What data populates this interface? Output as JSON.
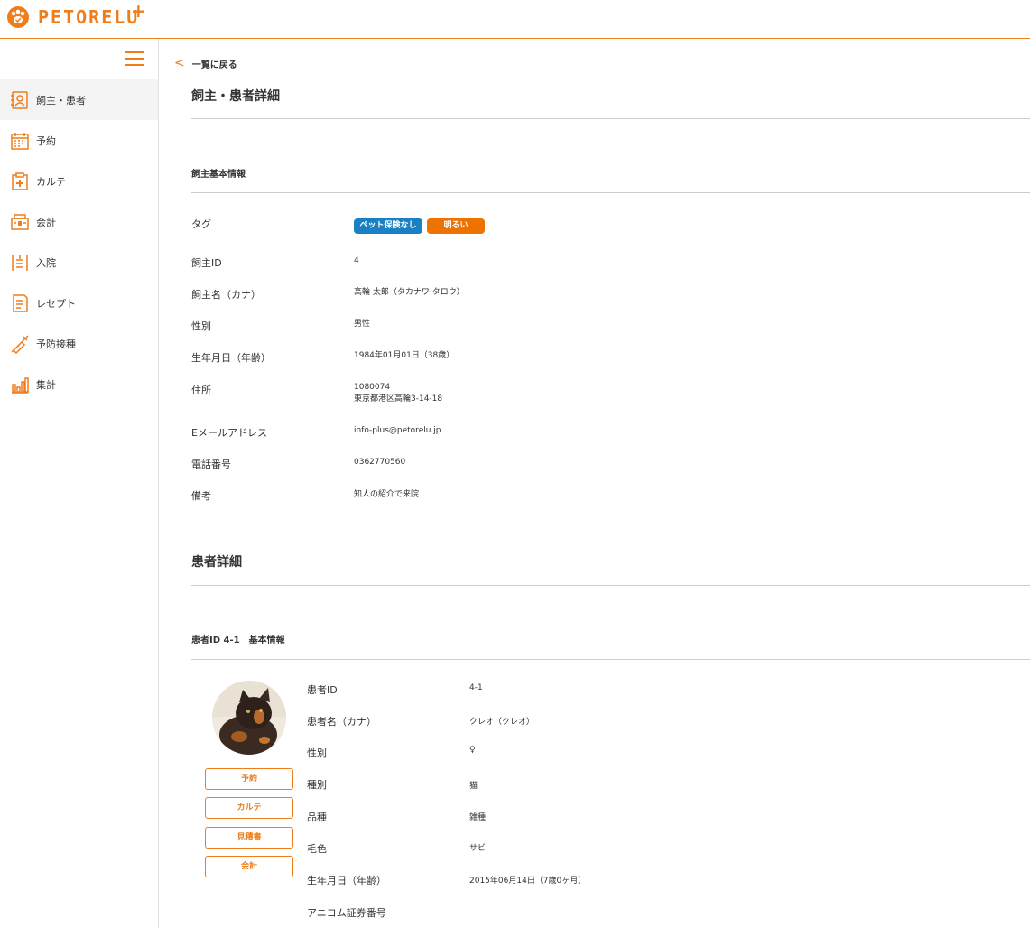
{
  "header": {
    "logo_text": "PETORELU",
    "logo_plus": "+"
  },
  "sidebar": {
    "items": [
      {
        "label": "飼主・患者",
        "icon": "owner-patient-icon"
      },
      {
        "label": "予約",
        "icon": "calendar-icon"
      },
      {
        "label": "カルテ",
        "icon": "medical-chart-icon"
      },
      {
        "label": "会計",
        "icon": "register-icon"
      },
      {
        "label": "入院",
        "icon": "hospitalization-icon"
      },
      {
        "label": "レセプト",
        "icon": "receipt-icon"
      },
      {
        "label": "予防接種",
        "icon": "syringe-icon"
      },
      {
        "label": "集計",
        "icon": "bar-chart-icon"
      }
    ]
  },
  "main": {
    "back_label": "一覧に戻る",
    "page_title": "飼主・患者詳細",
    "owner_section_title": "飼主基本情報",
    "tags": [
      {
        "label": "ペット保険なし",
        "color": "#1a80c4"
      },
      {
        "label": "明るい",
        "color": "#ee7200"
      }
    ],
    "owner_rows": [
      {
        "label": "タグ",
        "value": ""
      },
      {
        "label": "飼主ID",
        "value": "4"
      },
      {
        "label": "飼主名（カナ）",
        "value": "高輪 太郎（タカナワ タロウ）"
      },
      {
        "label": "性別",
        "value": "男性"
      },
      {
        "label": "生年月日（年齢）",
        "value": "1984年01月01日（38歳）"
      },
      {
        "label": "住所",
        "value": "1080074",
        "value2": "東京都港区高輪3-14-18"
      },
      {
        "label": "Eメールアドレス",
        "value": "info-plus@petorelu.jp"
      },
      {
        "label": "電話番号",
        "value": "0362770560"
      },
      {
        "label": "備考",
        "value": "知人の紹介で来院"
      }
    ],
    "patient_section_title": "患者詳細",
    "patient_sub_title": "患者ID 4-1　基本情報",
    "patient_buttons": [
      "予約",
      "カルテ",
      "見積書",
      "会計"
    ],
    "patient_rows": [
      {
        "label": "患者ID",
        "value": "4-1"
      },
      {
        "label": "患者名（カナ）",
        "value": "クレオ（クレオ）"
      },
      {
        "label": "性別",
        "value": "♀"
      },
      {
        "label": "種別",
        "value": "猫"
      },
      {
        "label": "品種",
        "value": "雑種"
      },
      {
        "label": "毛色",
        "value": "サビ"
      },
      {
        "label": "生年月日（年齢）",
        "value": "2015年06月14日（7歳0ヶ月）"
      },
      {
        "label": "アニコム証券番号",
        "value": ""
      }
    ]
  },
  "colors": {
    "accent": "#ee7d1a",
    "tag_blue": "#1a80c4",
    "tag_orange": "#ee7200"
  }
}
